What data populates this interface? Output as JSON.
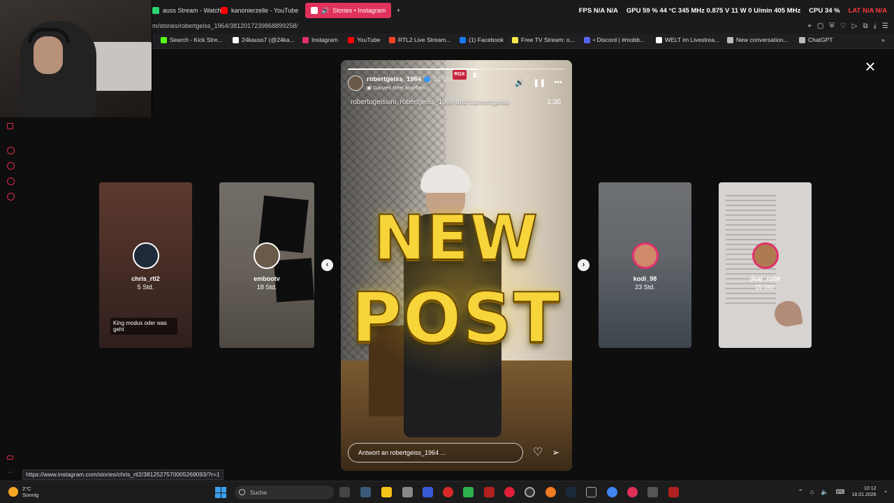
{
  "browser": {
    "tabs": [
      {
        "label": "auss Stream - Watch l",
        "active": false,
        "color": "#2bd56f"
      },
      {
        "label": "kanonierzelle - YouTube",
        "active": false,
        "color": "#ff0000"
      },
      {
        "label": "Stories • Instagram",
        "active": true,
        "color": "#e1306c"
      }
    ],
    "new_tab": "+",
    "url": "m/stories/robertgeiss_1964/3812017239868899258/",
    "bookmarks": [
      {
        "label": "Search - Kick Stre...",
        "color": "#53fc18"
      },
      {
        "label": "24kauss7 (@24ka...",
        "color": "#ffffff"
      },
      {
        "label": "Instagram",
        "color": "#e1306c"
      },
      {
        "label": "YouTube",
        "color": "#ff0000"
      },
      {
        "label": "RTL2 Live Stream...",
        "color": "#ff4422"
      },
      {
        "label": "(1) Facebook",
        "color": "#1877f2"
      },
      {
        "label": "Free TV Stream: o...",
        "color": "#f7e94b"
      },
      {
        "label": "• Discord | #mobb...",
        "color": "#5865f2"
      },
      {
        "label": "WELT im Livestrea...",
        "color": "#ffffff"
      },
      {
        "label": "New conversation...",
        "color": "#bbbbbb"
      },
      {
        "label": "ChatGPT",
        "color": "#bbbbbb"
      }
    ],
    "status_link": "https://www.instagram.com/stories/chris_rtl2/3812527570005269093/?r=1"
  },
  "overlay_stats": {
    "fps_label": "FPS",
    "fps_value": "N/A",
    "fps_value2": "N/A",
    "gpu_label": "GPU",
    "gpu_value": "59 % 44 °C 345 MHz 0.875 V 11 W 0 U/min 405 MHz",
    "cpu_label": "CPU",
    "cpu_value": "34 %",
    "lat_label": "LAT",
    "lat_value1": "N/A",
    "lat_value2": "N/A"
  },
  "stories": {
    "close_symbol": "×",
    "prev_arrow": "‹",
    "next_arrow": "›",
    "side_stories": [
      {
        "username": "chris_rtl2",
        "age": "5 Std.",
        "caption": "King modus oder was geht"
      },
      {
        "username": "embootv",
        "age": "18 Std."
      },
      {
        "username": "kodi_98",
        "age": "23 Std."
      },
      {
        "username": "dear_ruthi",
        "age": "15 Std."
      }
    ],
    "active": {
      "username": "robertgeiss_1964",
      "age": "22 Std.",
      "reel_link": "Ganzes Reel ansehen",
      "badge": "RGX",
      "collaborators": "robertogeissini, robertgeiss_1964 und carmengeiss",
      "duration": "1:30",
      "overlay_line1": "NEW",
      "overlay_line2": "POST",
      "reply_placeholder": "Antwort an robertgeiss_1964 ...",
      "progress": 0.6
    }
  },
  "taskbar": {
    "weather_temp": "2°C",
    "weather_desc": "Sonnig",
    "search_placeholder": "Suche",
    "time": "10:12",
    "date": "18.01.2026"
  }
}
